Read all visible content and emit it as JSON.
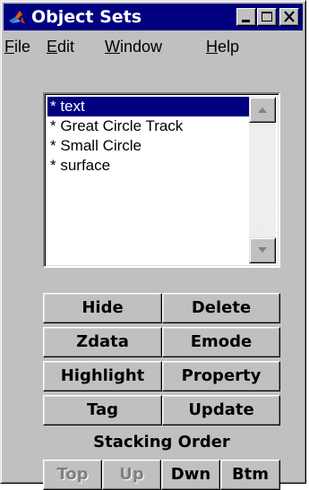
{
  "window": {
    "title": "Object Sets",
    "controls": [
      "minimize-icon",
      "maximize-icon",
      "close-icon"
    ]
  },
  "menu": {
    "file": {
      "accel": "F",
      "rest": "ile"
    },
    "edit": {
      "accel": "E",
      "rest": "dit"
    },
    "window": {
      "accel": "W",
      "rest": "indow"
    },
    "help": {
      "accel": "H",
      "rest": "elp"
    }
  },
  "object_list": {
    "items": [
      "* text",
      "* Great Circle Track",
      "* Small Circle",
      "* surface"
    ],
    "selected_index": 0
  },
  "buttons": {
    "hide": "Hide",
    "delete": "Delete",
    "zdata": "Zdata",
    "emode": "Emode",
    "highlight": "Highlight",
    "property": "Property",
    "tag": "Tag",
    "update": "Update"
  },
  "stacking": {
    "label": "Stacking Order",
    "top": "Top",
    "up": "Up",
    "dwn": "Dwn",
    "btm": "Btm",
    "disabled": [
      "Top",
      "Up"
    ]
  },
  "colors": {
    "title_bar": "#000080",
    "selection": "#000080",
    "face": "#c0c0c0",
    "disabled_text": "#808080"
  }
}
